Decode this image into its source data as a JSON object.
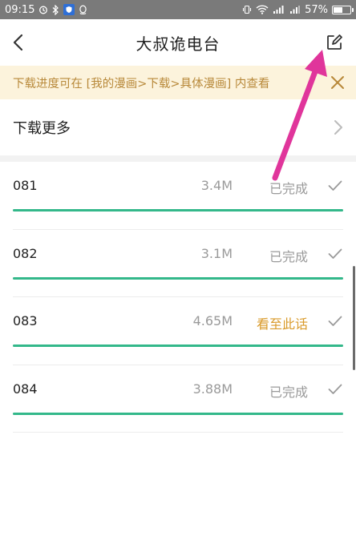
{
  "status_bar": {
    "time": "09:15",
    "battery": "57%",
    "battery_level": 0.57
  },
  "nav": {
    "title": "大叔诡电台"
  },
  "notice": {
    "text": "下载进度可在 [我的漫画>下载>具体漫画] 内查看"
  },
  "download_more": {
    "label": "下载更多"
  },
  "chapters": [
    {
      "number": "081",
      "size": "3.4M",
      "status": "已完成",
      "progress": 1.0,
      "current": false
    },
    {
      "number": "082",
      "size": "3.1M",
      "status": "已完成",
      "progress": 1.0,
      "current": false
    },
    {
      "number": "083",
      "size": "4.65M",
      "status": "看至此话",
      "progress": 1.0,
      "current": true
    },
    {
      "number": "084",
      "size": "3.88M",
      "status": "已完成",
      "progress": 1.0,
      "current": false
    }
  ],
  "colors": {
    "progress": "#33b88a",
    "notice_bg": "#fcf3dc",
    "notice_text": "#b8893a",
    "current_status": "#d99a2a",
    "annotation": "#e0359b"
  },
  "icons": {
    "back": "chevron-left-icon",
    "edit": "edit-icon",
    "close": "close-icon",
    "chevron": "chevron-right-icon",
    "check": "check-icon"
  }
}
